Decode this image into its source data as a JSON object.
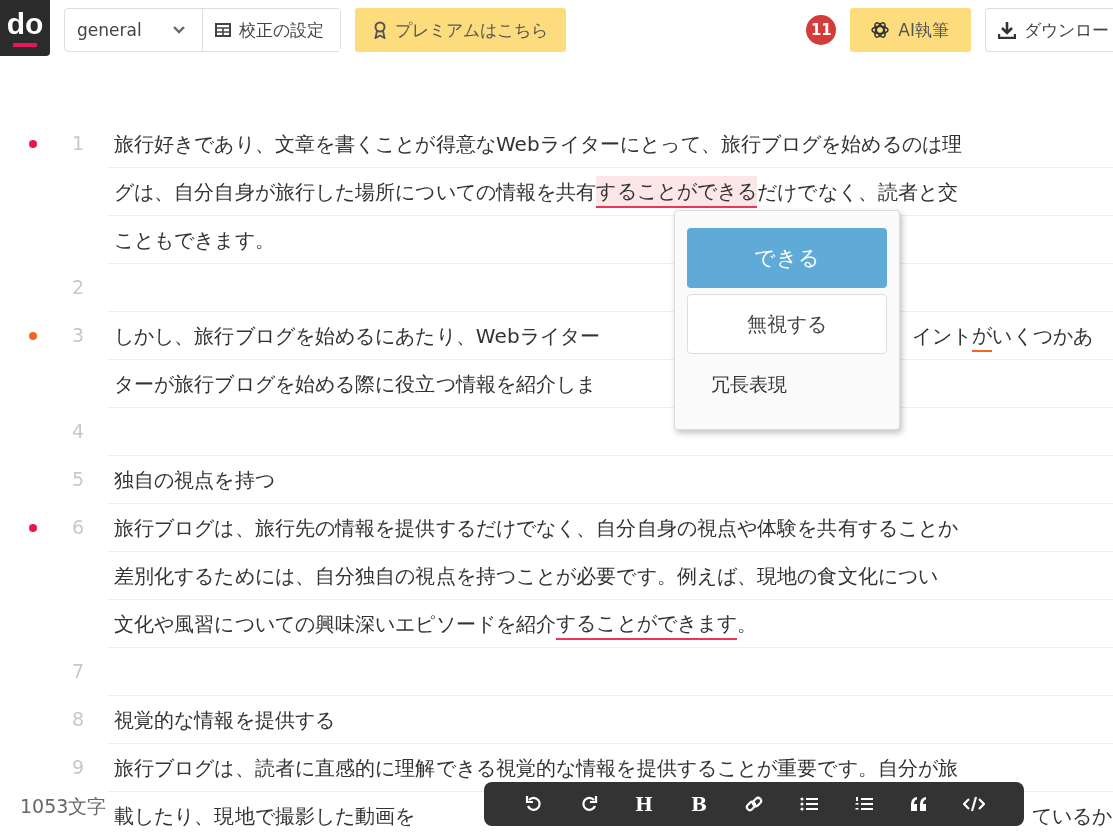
{
  "header": {
    "logo": "do",
    "select": {
      "value": "general"
    },
    "settings_button": "校正の設定",
    "premium_button": "プレミアムはこちら",
    "badge": "11",
    "ai_button": "AI執筆",
    "download_button": "ダウンロー"
  },
  "editor": {
    "paragraphs": [
      {
        "number": "1",
        "color": "#e8174a",
        "rows": [
          {
            "segments": [
              {
                "kind": "text",
                "text": "旅行好きであり、文章を書くことが得意なWebライターにとって、旅行ブログを始めるのは理"
              }
            ]
          },
          {
            "segments": [
              {
                "kind": "text",
                "text": "グは、自分自身が旅行した場所についての情報を共有"
              },
              {
                "kind": "error",
                "text": "することができる",
                "selected": true
              },
              {
                "kind": "text",
                "text": "だけでなく、読者と交"
              }
            ]
          },
          {
            "segments": [
              {
                "kind": "text",
                "text": "こともできます。"
              }
            ]
          }
        ]
      },
      {
        "number": "2",
        "rows": [
          {
            "segments": []
          }
        ]
      },
      {
        "number": "3",
        "color": "#f26522",
        "rows": [
          {
            "kind": "split_popup",
            "segments": [
              {
                "kind": "text",
                "text": "しかし、旅行ブログを始めるにあたり、Webライター"
              }
            ],
            "tail": [
              {
                "kind": "text",
                "text": "イント"
              },
              {
                "kind": "warning",
                "text": "が",
                "selected": false
              },
              {
                "kind": "text",
                "text": "いくつかあ"
              }
            ]
          },
          {
            "segments": [
              {
                "kind": "text",
                "text": "ターが旅行ブログを始める際に役立つ情報を紹介しま"
              }
            ]
          }
        ]
      },
      {
        "number": "4",
        "rows": [
          {
            "segments": []
          }
        ]
      },
      {
        "number": "5",
        "rows": [
          {
            "segments": [
              {
                "kind": "text",
                "text": "独自の視点を持つ"
              }
            ]
          }
        ]
      },
      {
        "number": "6",
        "color": "#e8174a",
        "rows": [
          {
            "segments": [
              {
                "kind": "text",
                "text": "旅行ブログは、旅行先の情報を提供するだけでなく、自分自身の視点や体験を共有することか"
              }
            ]
          },
          {
            "segments": [
              {
                "kind": "text",
                "text": "差別化するためには、自分独自の視点を持つことが必要です。例えば、現地の食文化につい"
              }
            ]
          },
          {
            "segments": [
              {
                "kind": "text",
                "text": "文化や風習についての興味深いエピソードを紹介"
              },
              {
                "kind": "error",
                "text": "することができます",
                "selected": false
              },
              {
                "kind": "text",
                "text": "。"
              }
            ]
          }
        ]
      },
      {
        "number": "7",
        "rows": [
          {
            "segments": []
          }
        ]
      },
      {
        "number": "8",
        "rows": [
          {
            "segments": [
              {
                "kind": "text",
                "text": "視覚的な情報を提供する"
              }
            ]
          }
        ]
      },
      {
        "number": "9",
        "rows": [
          {
            "segments": [
              {
                "kind": "text",
                "text": "旅行ブログは、読者に直感的に理解できる視覚的な情報を提供することが重要です。自分が旅"
              }
            ]
          },
          {
            "kind": "split_toolbar",
            "segments": [
              {
                "kind": "text",
                "text": "載したり、現地で撮影した動画を"
              }
            ],
            "tail": [
              {
                "kind": "text",
                "text": "ているか"
              }
            ]
          }
        ]
      }
    ]
  },
  "popup": {
    "suggestion_button": "できる",
    "ignore_button": "無視する",
    "category": "冗長表現"
  },
  "char_count": "1053文字",
  "toolbar": [
    {
      "kind": "undo"
    },
    {
      "kind": "redo"
    },
    {
      "kind": "heading",
      "label": "H"
    },
    {
      "kind": "bold",
      "label": "B"
    },
    {
      "kind": "link"
    },
    {
      "kind": "bullet_list"
    },
    {
      "kind": "numbered_list"
    },
    {
      "kind": "quote"
    },
    {
      "kind": "code"
    }
  ]
}
